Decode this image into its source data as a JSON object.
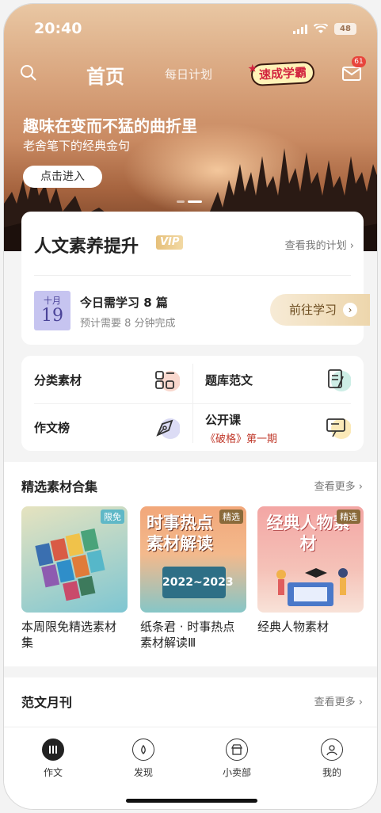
{
  "status": {
    "time": "20:40",
    "battery": "48"
  },
  "nav": {
    "home": "首页",
    "plan": "每日计划",
    "badge": "速成学霸",
    "mail_count": "61"
  },
  "banner": {
    "title": "趣味在变而不猛的曲折里",
    "subtitle": "老舍笔下的经典金句",
    "button": "点击进入"
  },
  "plan_card": {
    "title": "人文素养提升",
    "vip": "VIP",
    "link": "查看我的计划",
    "month": "十月",
    "day": "19",
    "today": "今日需学习 8 篇",
    "estimate": "预计需要 8 分钟完成",
    "go": "前往学习"
  },
  "grid": [
    {
      "label": "分类素材"
    },
    {
      "label": "题库范文"
    },
    {
      "label": "作文榜"
    },
    {
      "label": "公开课",
      "sub": "《破格》第一期"
    }
  ],
  "featured": {
    "title": "精选素材合集",
    "more": "查看更多",
    "items": [
      {
        "tag": "限免",
        "caption": "本周限免精选素材集",
        "tag_color": "#5fb8c7"
      },
      {
        "tag": "精选",
        "caption": "纸条君 · 时事热点素材解读Ⅲ",
        "img_text": "时事热点素材解读",
        "img_year": "2022~2023",
        "tag_color": "#8a6a3a"
      },
      {
        "tag": "精选",
        "caption": "经典人物素材",
        "img_text": "经典人物素材",
        "tag_color": "#8a6a3a"
      }
    ]
  },
  "monthly": {
    "title": "范文月刊",
    "more": "查看更多"
  },
  "tabs": [
    {
      "label": "作文"
    },
    {
      "label": "发现"
    },
    {
      "label": "小卖部"
    },
    {
      "label": "我的"
    }
  ]
}
